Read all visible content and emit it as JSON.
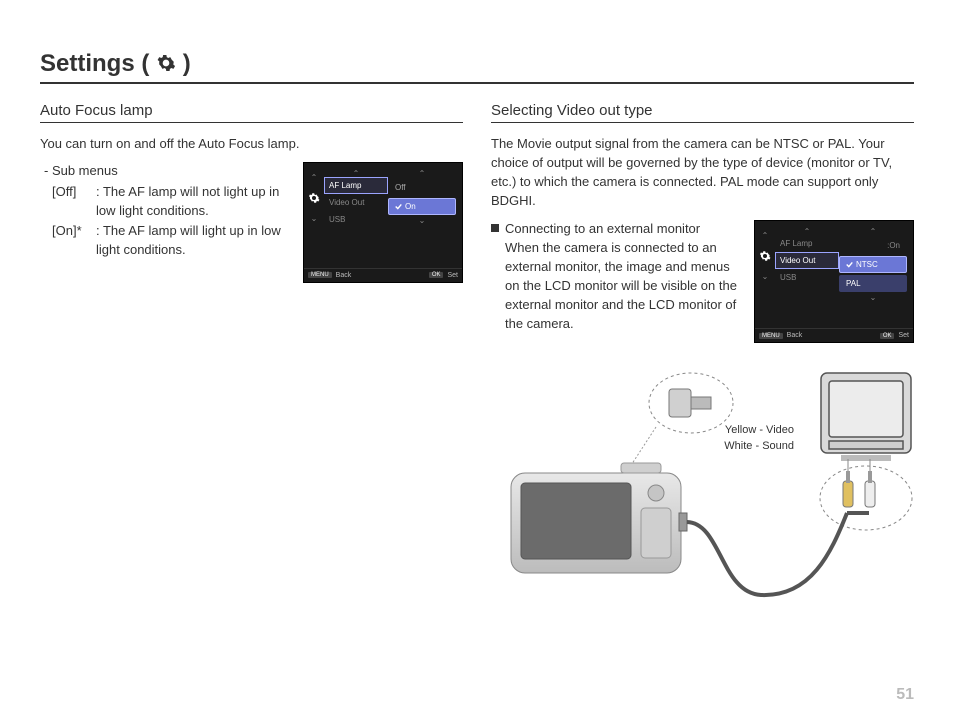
{
  "page_title_prefix": "Settings ( ",
  "page_title_suffix": " )",
  "page_number": "51",
  "left": {
    "heading": "Auto Focus lamp",
    "intro": "You can turn on and off the Auto Focus lamp.",
    "sub_label": "- Sub menus",
    "items": [
      {
        "key": "[Off]",
        "desc": ": The AF lamp will not light up in low light conditions."
      },
      {
        "key": "[On]*",
        "desc": ": The AF lamp will light up in low light conditions."
      }
    ],
    "lcd": {
      "list": [
        "AF Lamp",
        "Video Out",
        "USB"
      ],
      "selected_list_index": 0,
      "values": [
        "Off",
        "On"
      ],
      "checked_value_index": 1,
      "selected_value_index": 1,
      "footer_back_btn": "MENU",
      "footer_back": "Back",
      "footer_set_btn": "OK",
      "footer_set": "Set"
    }
  },
  "right": {
    "heading": "Selecting Video out type",
    "intro": "The Movie output signal from the camera can be NTSC or PAL. Your choice of output will be governed by the type of device (monitor or TV, etc.) to which the camera is connected. PAL mode can support only BDGHI.",
    "conn_title": "Connecting to an external monitor",
    "conn_body": "When the camera is connected to an external monitor, the image and menus on the LCD monitor will be visible on the external monitor and the LCD monitor of the camera.",
    "lcd": {
      "list": [
        "AF Lamp",
        "Video Out",
        "USB"
      ],
      "selected_list_index": 1,
      "right_label": ":On",
      "values": [
        "NTSC",
        "PAL"
      ],
      "checked_value_index": 0,
      "selected_value_index": 0,
      "footer_back_btn": "MENU",
      "footer_back": "Back",
      "footer_set_btn": "OK",
      "footer_set": "Set"
    },
    "illus": {
      "label_video": "Yellow - Video",
      "label_sound": "White - Sound"
    }
  }
}
